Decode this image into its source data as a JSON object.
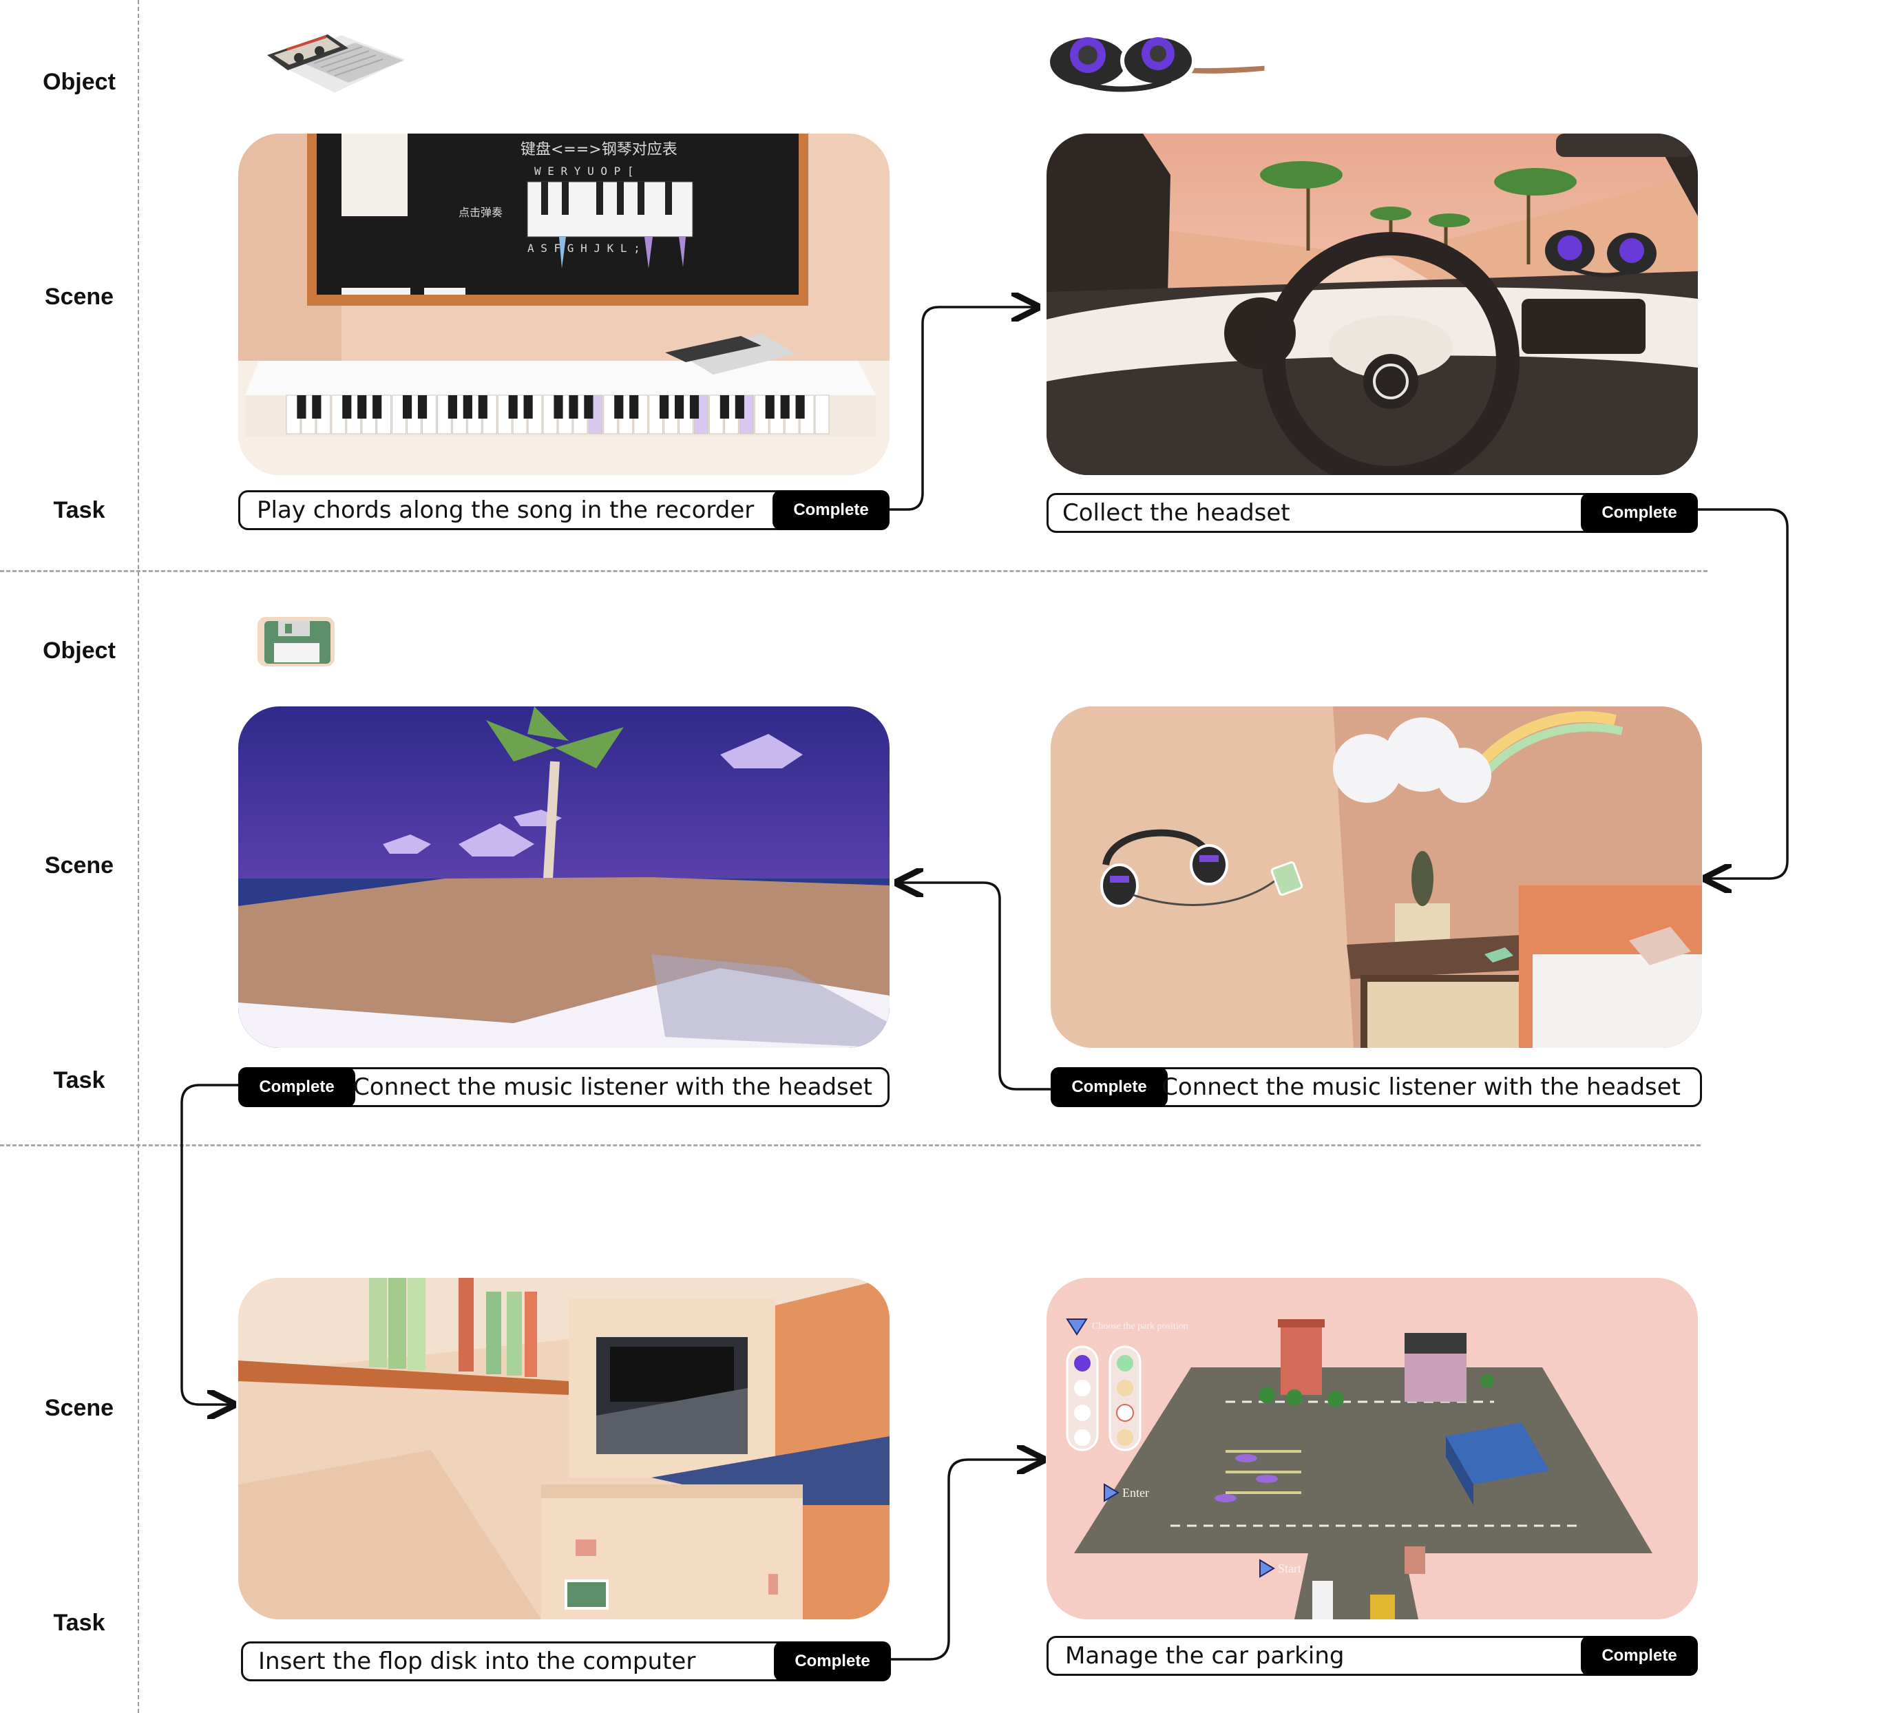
{
  "row_labels": {
    "object": "Object",
    "scene": "Scene",
    "task": "Task"
  },
  "tasks": {
    "t1": {
      "text": "Play chords along the song in the recorder",
      "button": "Complete"
    },
    "t2": {
      "text": "Collect the headset",
      "button": "Complete"
    },
    "t3": {
      "text": "Connect the music listener with the headset",
      "button": "Complete"
    },
    "t4": {
      "text": "Connect the music listener with the headset",
      "button": "Complete"
    },
    "t5": {
      "text": "Insert the flop disk into the computer",
      "button": "Complete"
    },
    "t6": {
      "text": "Manage the car parking",
      "button": "Complete"
    }
  },
  "scenes": {
    "piano_board": {
      "line1": "键盘<==>钢琴对应表",
      "keys_top": "W E R Y U O P [",
      "keys_bottom": "A S F G H J K L ;",
      "label": "点击弹奏"
    },
    "parking": {
      "hint": "Choose the park position",
      "enter": "Enter",
      "start": "Start"
    }
  },
  "objects": [
    "cassette-recorder",
    "headset",
    "floppy-disk"
  ],
  "colors": {
    "accent": "#000000",
    "arrow": "#111111",
    "purple": "#6a3ad8",
    "sky": "#3b2f9a",
    "pink_bg": "#f6cdc4"
  }
}
